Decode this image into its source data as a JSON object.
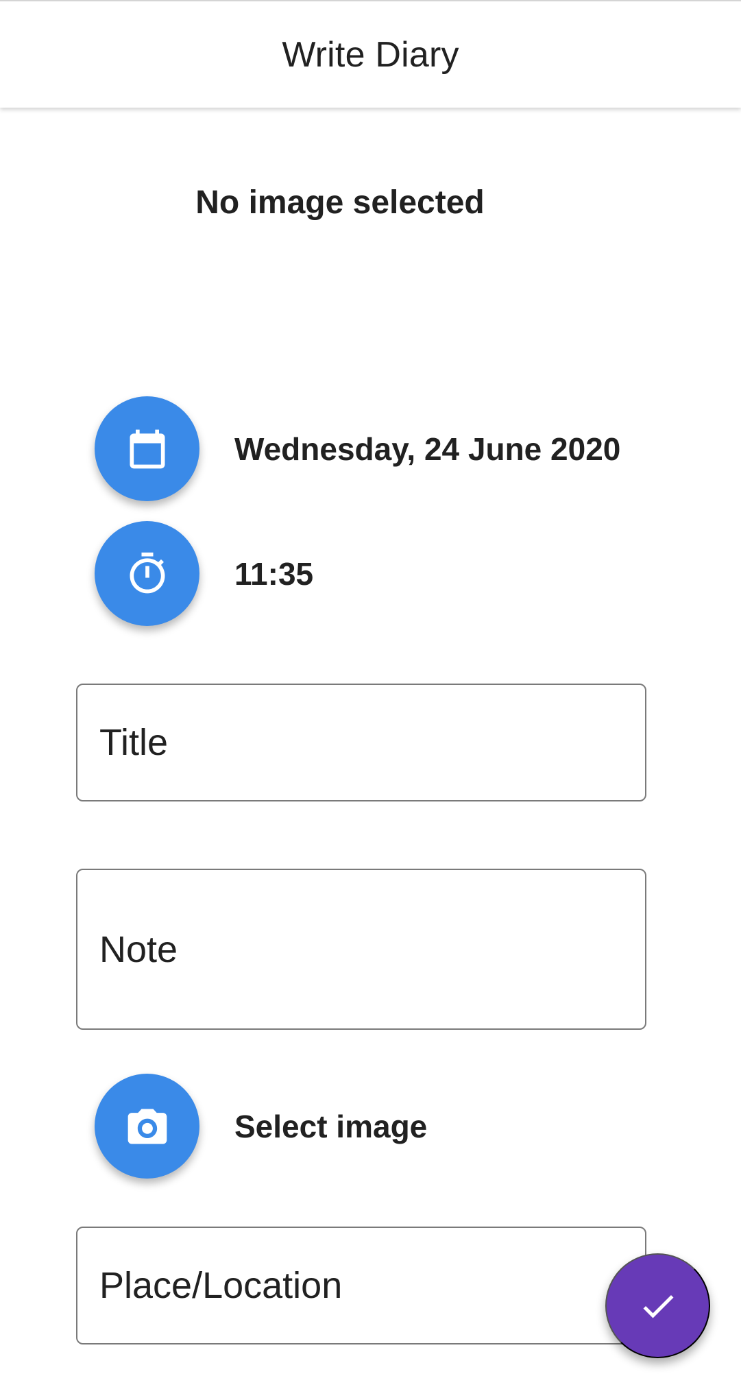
{
  "app_bar": {
    "title": "Write Diary"
  },
  "image_status": "No image selected",
  "date_row": {
    "icon": "calendar-icon",
    "label": "Wednesday, 24 June 2020"
  },
  "time_row": {
    "icon": "timer-icon",
    "label": "11:35"
  },
  "fields": {
    "title": "Title",
    "note": "Note",
    "place": "Place/Location"
  },
  "image_row": {
    "icon": "camera-icon",
    "label": "Select image"
  },
  "fab": {
    "icon": "check-icon"
  },
  "colors": {
    "accent": "#3a8ae8",
    "fab": "#673ab7",
    "text": "#212121"
  }
}
